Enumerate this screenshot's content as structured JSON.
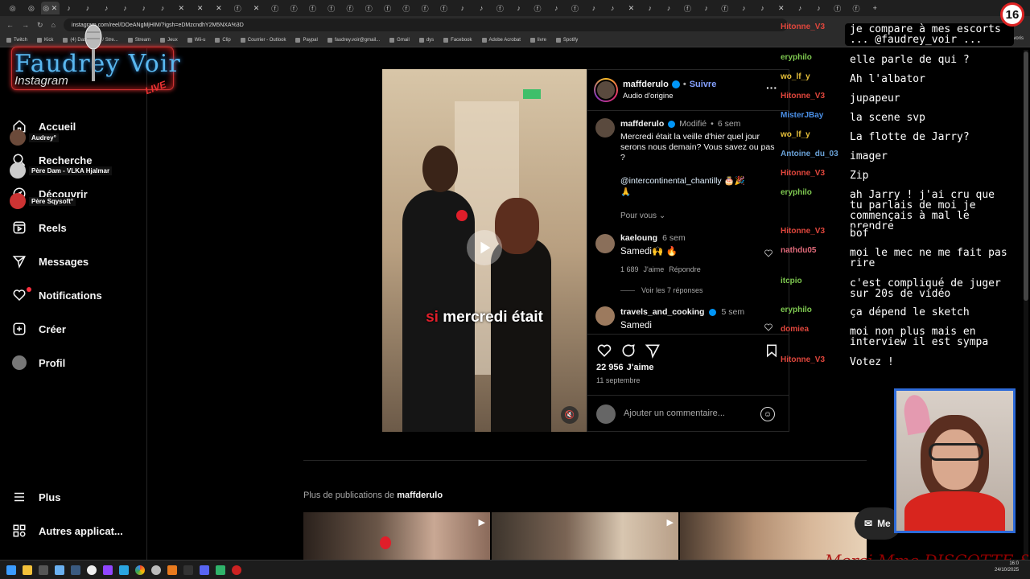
{
  "browser": {
    "url": "instagram.com/reel/DOeANgMjHIM/?igsh=eDMzcndhY2M5NXA%3D",
    "bookmarks": [
      "Twitch",
      "Kick",
      "(4) Dashboard / Stre...",
      "Stream",
      "Jeux",
      "Wii-u",
      "Clip",
      "Courrier - Outlook",
      "Paypal",
      "faudrey.voir@gmail...",
      "Gmail",
      "dys",
      "Facebook",
      "Adobe Acrobat",
      "livre",
      "Spotify"
    ],
    "all_favorites": "Tous les favoris"
  },
  "overlay": {
    "logo_title": "Faudrey Voir",
    "logo_sub": "Instagram",
    "logo_live": "LIVE",
    "age_badge": "16",
    "bottom_banner": "Merci Mme DISCOTTE &"
  },
  "sidebar": {
    "items": [
      {
        "label": "Accueil",
        "icon": "home-icon"
      },
      {
        "label": "Recherche",
        "icon": "search-icon"
      },
      {
        "label": "Découvrir",
        "icon": "compass-icon"
      },
      {
        "label": "Reels",
        "icon": "reels-icon"
      },
      {
        "label": "Messages",
        "icon": "send-icon"
      },
      {
        "label": "Notifications",
        "icon": "heart-icon"
      },
      {
        "label": "Créer",
        "icon": "plus-square-icon"
      },
      {
        "label": "Profil",
        "icon": "avatar"
      }
    ],
    "bottom_items": [
      {
        "label": "Plus",
        "icon": "menu-icon"
      },
      {
        "label": "Autres applicat...",
        "icon": "grid-icon"
      }
    ],
    "viewer_tags": [
      "Audrey°",
      "Père Dam - VLKA Hjalmar",
      "Père Sqysoft°"
    ]
  },
  "post": {
    "author": "maffderulo",
    "follow": "Suivre",
    "audio": "Audio d'origine",
    "caption_author": "maffderulo",
    "modified": "Modifié",
    "caption_time": "6 sem",
    "caption": "Mercredi était la veille d'hier quel jour serons nous  demain? Vous savez ou pas ?",
    "mention": "@intercontinental_chantilly",
    "mention_emoji": "🎂🎉",
    "extra_emoji": "🙏",
    "see_more": "Pour vous",
    "video_caption_red": "si",
    "video_caption": "mercredi était",
    "comments": [
      {
        "user": "kaeloung",
        "time": "6 sem",
        "text": "Samedi🙌 🔥",
        "likes": "1 689",
        "likes_label": "J'aime",
        "reply": "Répondre",
        "view_replies": "Voir les 7 réponses"
      },
      {
        "user": "travels_and_cooking",
        "time": "5 sem",
        "text": "Samedi"
      }
    ],
    "like_count": "22 956",
    "like_label": "J'aime",
    "date": "11 septembre",
    "comment_placeholder": "Ajouter un commentaire..."
  },
  "more_posts": {
    "label_prefix": "Plus de publications de",
    "label_user": "maffderulo"
  },
  "messenger_label": "Me",
  "chat": [
    {
      "user": "Hitonne_V3",
      "color": "#e0463c",
      "msg": "je compare à mes escorts ... @faudrey_voir ..."
    },
    {
      "user": "eryphilo",
      "color": "#7ec850",
      "msg": "elle parle de qui ?"
    },
    {
      "user": "wo_lf_y",
      "color": "#e8c13a",
      "msg": "Ah l'albator"
    },
    {
      "user": "Hitonne_V3",
      "color": "#e0463c",
      "msg": "jupapeur"
    },
    {
      "user": "MisterJBay",
      "color": "#4a8fe6",
      "msg": "la scene svp"
    },
    {
      "user": "wo_lf_y",
      "color": "#e8c13a",
      "msg": "La flotte de Jarry?"
    },
    {
      "user": "Antoine_du_03",
      "color": "#6aa2d8",
      "msg": "imager"
    },
    {
      "user": "Hitonne_V3",
      "color": "#e0463c",
      "msg": "Zip"
    },
    {
      "user": "eryphilo",
      "color": "#7ec850",
      "msg": "ah Jarry ! j'ai cru que tu parlais de moi je commençais à mal le prendre"
    },
    {
      "user": "Hitonne_V3",
      "color": "#e0463c",
      "msg": "bof"
    },
    {
      "user": "nathdu05",
      "color": "#e06a7a",
      "msg": "moi le mec ne me fait pas rire"
    },
    {
      "user": "itcpio",
      "color": "#7ec850",
      "msg": "c'est compliqué de juger sur 20s de vidéo"
    },
    {
      "user": "eryphilo",
      "color": "#7ec850",
      "msg": "ça dépend le sketch"
    },
    {
      "user": "domiea",
      "color": "#e0463c",
      "msg": "moi non plus mais en interview il est sympa"
    },
    {
      "user": "Hitonne_V3",
      "color": "#e0463c",
      "msg": "Votez !"
    }
  ],
  "clock": {
    "time": "16:0",
    "date": "24/10/2025"
  }
}
